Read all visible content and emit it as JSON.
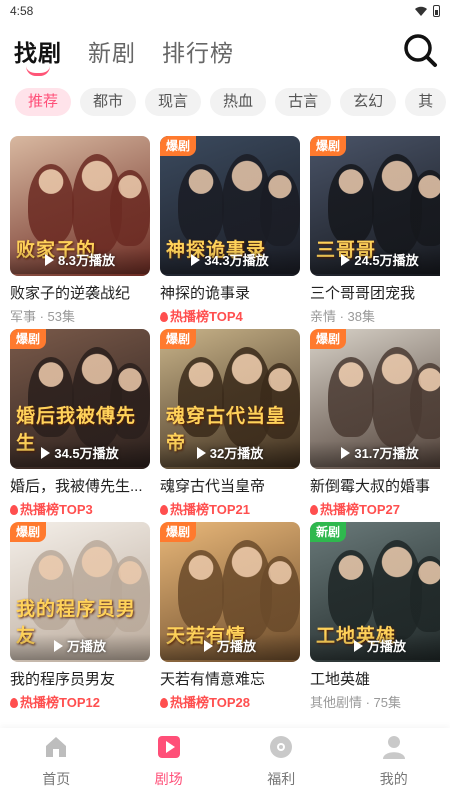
{
  "status_bar": {
    "time": "4:58"
  },
  "top_nav": {
    "tabs": [
      {
        "label": "找剧",
        "active": true
      },
      {
        "label": "新剧",
        "active": false
      },
      {
        "label": "排行榜",
        "active": false
      }
    ],
    "search_icon": "search-icon"
  },
  "chips": [
    {
      "label": "推荐",
      "active": true
    },
    {
      "label": "都市",
      "active": false
    },
    {
      "label": "现言",
      "active": false
    },
    {
      "label": "热血",
      "active": false
    },
    {
      "label": "古言",
      "active": false
    },
    {
      "label": "玄幻",
      "active": false
    },
    {
      "label": "其",
      "active": false
    }
  ],
  "dramas": [
    {
      "title": "败家子的逆袭战纪",
      "badge": "",
      "plays": "8.3万播放",
      "poster_text": "败家子的",
      "meta": "军事 · 53集",
      "meta_type": "info",
      "colors": [
        "#d8b8a0",
        "#6b2a22"
      ]
    },
    {
      "title": "神探的诡事录",
      "badge": "爆剧",
      "plays": "34.3万播放",
      "poster_text": "神探诡事录",
      "meta": "热播榜TOP4",
      "meta_type": "rank",
      "colors": [
        "#3b4a5e",
        "#1a1c24"
      ]
    },
    {
      "title": "三个哥哥团宠我",
      "badge": "爆剧",
      "plays": "24.5万播放",
      "poster_text": "三哥哥",
      "meta": "亲情 · 38集",
      "meta_type": "info",
      "colors": [
        "#4a5468",
        "#15171c"
      ]
    },
    {
      "title": "婚后，我被傅先生...",
      "badge": "爆剧",
      "plays": "34.5万播放",
      "poster_text": "婚后我被傅先生",
      "meta": "热播榜TOP3",
      "meta_type": "rank",
      "colors": [
        "#7a5a4a",
        "#2a1f1c"
      ]
    },
    {
      "title": "魂穿古代当皇帝",
      "badge": "爆剧",
      "plays": "32万播放",
      "poster_text": "魂穿古代当皇帝",
      "meta": "热播榜TOP21",
      "meta_type": "rank",
      "colors": [
        "#c9b48a",
        "#3a2a1a"
      ]
    },
    {
      "title": "新倒霉大叔的婚事",
      "badge": "爆剧",
      "plays": "31.7万播放",
      "poster_text": "",
      "meta": "热播榜TOP27",
      "meta_type": "rank",
      "colors": [
        "#d8d2c8",
        "#4a3a32"
      ]
    },
    {
      "title": "我的程序员男友",
      "badge": "爆剧",
      "plays": "万播放",
      "poster_text": "我的程序员男友",
      "meta": "热播榜TOP12",
      "meta_type": "rank",
      "colors": [
        "#f4efe9",
        "#b9a99a"
      ]
    },
    {
      "title": "天若有情意难忘",
      "badge": "爆剧",
      "plays": "万播放",
      "poster_text": "天若有情",
      "meta": "热播榜TOP28",
      "meta_type": "rank",
      "colors": [
        "#e9b87a",
        "#6a4a2a"
      ]
    },
    {
      "title": "工地英雄",
      "badge": "新剧",
      "plays": "万播放",
      "poster_text": "工地英雄",
      "meta": "其他剧情 · 75集",
      "meta_type": "info",
      "colors": [
        "#6a7a7a",
        "#1e2626"
      ]
    }
  ],
  "bottom_nav": [
    {
      "label": "首页",
      "icon": "home-icon",
      "active": false
    },
    {
      "label": "剧场",
      "icon": "theater-play-icon",
      "active": true
    },
    {
      "label": "福利",
      "icon": "welfare-disc-icon",
      "active": false
    },
    {
      "label": "我的",
      "icon": "profile-icon",
      "active": false
    }
  ],
  "colors": {
    "accent": "#ff4f78",
    "hot_badge": "#ff7a2e",
    "new_badge": "#2fb84e",
    "rank_text": "#ff4f4f"
  }
}
